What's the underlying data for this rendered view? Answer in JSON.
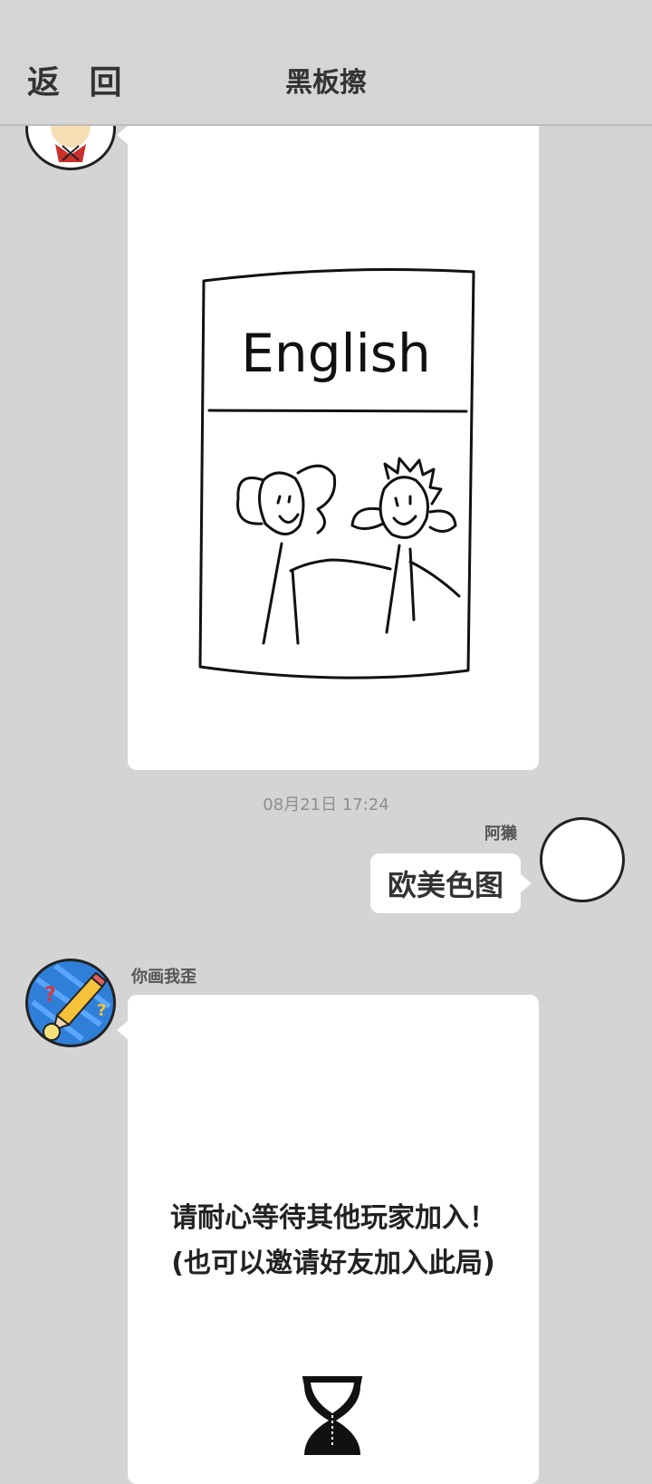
{
  "header": {
    "back_label": "返 回",
    "title": "黑板擦"
  },
  "messages": {
    "drawing_caption": "English",
    "timestamp": "08月21日  17:24",
    "user_name": "阿獭",
    "user_message": "欧美色图",
    "system_name": "你画我歪",
    "system_line1": "请耐心等待其他玩家加入！",
    "system_line2": "(也可以邀请好友加入此局)"
  },
  "colors": {
    "background": "#d4d4d4",
    "bubble": "#ffffff",
    "text": "#333333",
    "timestamp": "#8e8e8e",
    "app_avatar": "#2f7fd8"
  },
  "icons": [
    "back-icon",
    "pencil-icon",
    "hourglass-icon"
  ]
}
